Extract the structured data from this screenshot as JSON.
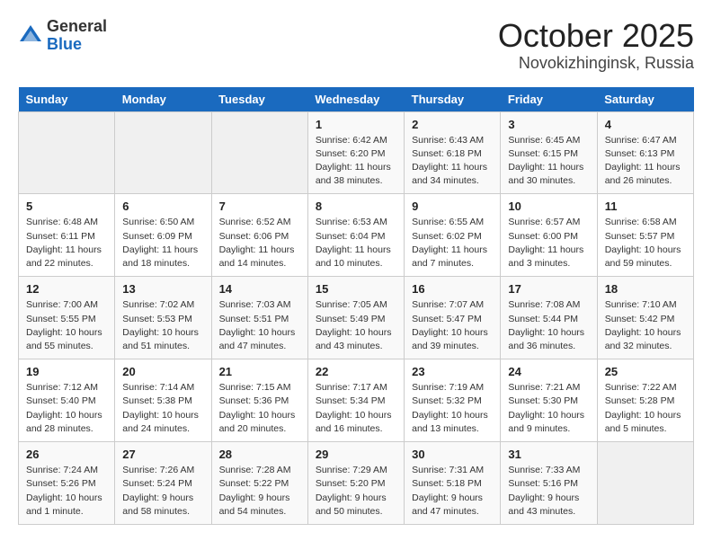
{
  "header": {
    "logo_general": "General",
    "logo_blue": "Blue",
    "month_title": "October 2025",
    "location": "Novokizhinginsk, Russia"
  },
  "weekdays": [
    "Sunday",
    "Monday",
    "Tuesday",
    "Wednesday",
    "Thursday",
    "Friday",
    "Saturday"
  ],
  "weeks": [
    [
      {
        "day": "",
        "info": ""
      },
      {
        "day": "",
        "info": ""
      },
      {
        "day": "",
        "info": ""
      },
      {
        "day": "1",
        "info": "Sunrise: 6:42 AM\nSunset: 6:20 PM\nDaylight: 11 hours\nand 38 minutes."
      },
      {
        "day": "2",
        "info": "Sunrise: 6:43 AM\nSunset: 6:18 PM\nDaylight: 11 hours\nand 34 minutes."
      },
      {
        "day": "3",
        "info": "Sunrise: 6:45 AM\nSunset: 6:15 PM\nDaylight: 11 hours\nand 30 minutes."
      },
      {
        "day": "4",
        "info": "Sunrise: 6:47 AM\nSunset: 6:13 PM\nDaylight: 11 hours\nand 26 minutes."
      }
    ],
    [
      {
        "day": "5",
        "info": "Sunrise: 6:48 AM\nSunset: 6:11 PM\nDaylight: 11 hours\nand 22 minutes."
      },
      {
        "day": "6",
        "info": "Sunrise: 6:50 AM\nSunset: 6:09 PM\nDaylight: 11 hours\nand 18 minutes."
      },
      {
        "day": "7",
        "info": "Sunrise: 6:52 AM\nSunset: 6:06 PM\nDaylight: 11 hours\nand 14 minutes."
      },
      {
        "day": "8",
        "info": "Sunrise: 6:53 AM\nSunset: 6:04 PM\nDaylight: 11 hours\nand 10 minutes."
      },
      {
        "day": "9",
        "info": "Sunrise: 6:55 AM\nSunset: 6:02 PM\nDaylight: 11 hours\nand 7 minutes."
      },
      {
        "day": "10",
        "info": "Sunrise: 6:57 AM\nSunset: 6:00 PM\nDaylight: 11 hours\nand 3 minutes."
      },
      {
        "day": "11",
        "info": "Sunrise: 6:58 AM\nSunset: 5:57 PM\nDaylight: 10 hours\nand 59 minutes."
      }
    ],
    [
      {
        "day": "12",
        "info": "Sunrise: 7:00 AM\nSunset: 5:55 PM\nDaylight: 10 hours\nand 55 minutes."
      },
      {
        "day": "13",
        "info": "Sunrise: 7:02 AM\nSunset: 5:53 PM\nDaylight: 10 hours\nand 51 minutes."
      },
      {
        "day": "14",
        "info": "Sunrise: 7:03 AM\nSunset: 5:51 PM\nDaylight: 10 hours\nand 47 minutes."
      },
      {
        "day": "15",
        "info": "Sunrise: 7:05 AM\nSunset: 5:49 PM\nDaylight: 10 hours\nand 43 minutes."
      },
      {
        "day": "16",
        "info": "Sunrise: 7:07 AM\nSunset: 5:47 PM\nDaylight: 10 hours\nand 39 minutes."
      },
      {
        "day": "17",
        "info": "Sunrise: 7:08 AM\nSunset: 5:44 PM\nDaylight: 10 hours\nand 36 minutes."
      },
      {
        "day": "18",
        "info": "Sunrise: 7:10 AM\nSunset: 5:42 PM\nDaylight: 10 hours\nand 32 minutes."
      }
    ],
    [
      {
        "day": "19",
        "info": "Sunrise: 7:12 AM\nSunset: 5:40 PM\nDaylight: 10 hours\nand 28 minutes."
      },
      {
        "day": "20",
        "info": "Sunrise: 7:14 AM\nSunset: 5:38 PM\nDaylight: 10 hours\nand 24 minutes."
      },
      {
        "day": "21",
        "info": "Sunrise: 7:15 AM\nSunset: 5:36 PM\nDaylight: 10 hours\nand 20 minutes."
      },
      {
        "day": "22",
        "info": "Sunrise: 7:17 AM\nSunset: 5:34 PM\nDaylight: 10 hours\nand 16 minutes."
      },
      {
        "day": "23",
        "info": "Sunrise: 7:19 AM\nSunset: 5:32 PM\nDaylight: 10 hours\nand 13 minutes."
      },
      {
        "day": "24",
        "info": "Sunrise: 7:21 AM\nSunset: 5:30 PM\nDaylight: 10 hours\nand 9 minutes."
      },
      {
        "day": "25",
        "info": "Sunrise: 7:22 AM\nSunset: 5:28 PM\nDaylight: 10 hours\nand 5 minutes."
      }
    ],
    [
      {
        "day": "26",
        "info": "Sunrise: 7:24 AM\nSunset: 5:26 PM\nDaylight: 10 hours\nand 1 minute."
      },
      {
        "day": "27",
        "info": "Sunrise: 7:26 AM\nSunset: 5:24 PM\nDaylight: 9 hours\nand 58 minutes."
      },
      {
        "day": "28",
        "info": "Sunrise: 7:28 AM\nSunset: 5:22 PM\nDaylight: 9 hours\nand 54 minutes."
      },
      {
        "day": "29",
        "info": "Sunrise: 7:29 AM\nSunset: 5:20 PM\nDaylight: 9 hours\nand 50 minutes."
      },
      {
        "day": "30",
        "info": "Sunrise: 7:31 AM\nSunset: 5:18 PM\nDaylight: 9 hours\nand 47 minutes."
      },
      {
        "day": "31",
        "info": "Sunrise: 7:33 AM\nSunset: 5:16 PM\nDaylight: 9 hours\nand 43 minutes."
      },
      {
        "day": "",
        "info": ""
      }
    ]
  ]
}
